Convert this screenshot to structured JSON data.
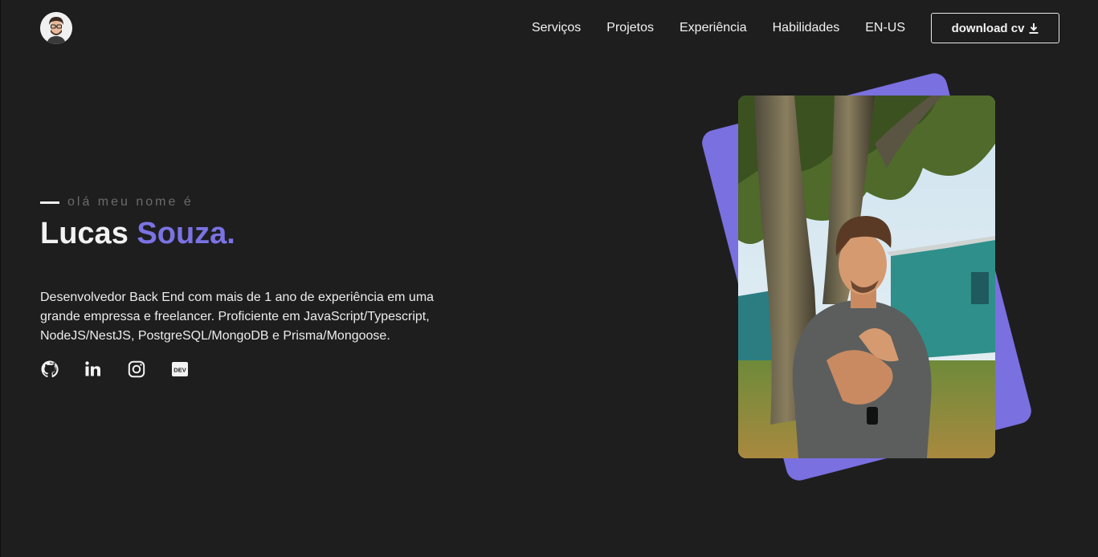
{
  "header": {
    "logo_alt": "avatar",
    "nav": [
      {
        "label": "Serviços"
      },
      {
        "label": "Projetos"
      },
      {
        "label": "Experiência"
      },
      {
        "label": "Habilidades"
      },
      {
        "label": "EN-US"
      }
    ],
    "cv_button": "download cv",
    "cv_icon": "download-icon"
  },
  "hero": {
    "greeting": "olá meu nome é",
    "first_name": "Lucas",
    "last_name": "Souza.",
    "description": "Desenvolvedor Back End com mais de 1 ano de experiência em uma grande empressa e freelancer. Proficiente em JavaScript/Typescript, NodeJS/NestJS, PostgreSQL/MongoDB e Prisma/Mongoose.",
    "socials": [
      {
        "icon": "github-icon"
      },
      {
        "icon": "linkedin-icon"
      },
      {
        "icon": "instagram-icon"
      },
      {
        "icon": "dev-to-icon"
      }
    ]
  },
  "colors": {
    "background": "#1e1e1f",
    "accent": "#7b73e4",
    "text": "#f2f2f2"
  }
}
